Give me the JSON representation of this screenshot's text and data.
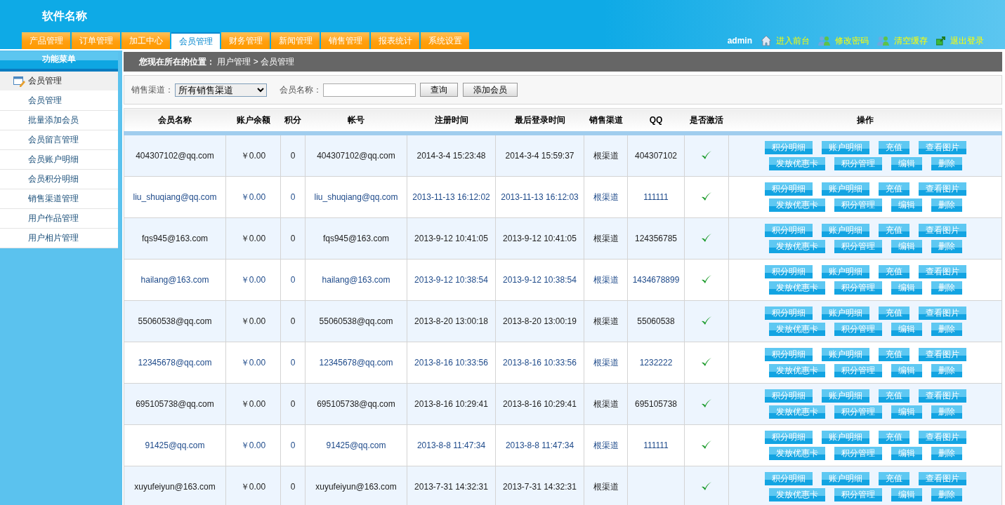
{
  "header": {
    "title": "软件名称",
    "user": "admin",
    "links": [
      {
        "kind": "home",
        "label": "进入前台"
      },
      {
        "kind": "users",
        "label": "修改密码"
      },
      {
        "kind": "users",
        "label": "清空缓存"
      },
      {
        "kind": "exit",
        "label": "退出登录"
      }
    ]
  },
  "tabs": [
    {
      "label": "产品管理",
      "selected": false
    },
    {
      "label": "订单管理",
      "selected": false
    },
    {
      "label": "加工中心",
      "selected": false
    },
    {
      "label": "会员管理",
      "selected": true
    },
    {
      "label": "财务管理",
      "selected": false
    },
    {
      "label": "新闻管理",
      "selected": false
    },
    {
      "label": "销售管理",
      "selected": false
    },
    {
      "label": "报表统计",
      "selected": false
    },
    {
      "label": "系统设置",
      "selected": false
    }
  ],
  "sidebar": {
    "title": "功能菜单",
    "groups": [
      {
        "label": "会员管理",
        "children": [
          {
            "label": "会员管理"
          },
          {
            "label": "批量添加会员"
          },
          {
            "label": "会员留言管理"
          },
          {
            "label": "会员账户明细"
          },
          {
            "label": "会员积分明细"
          },
          {
            "label": "销售渠道管理"
          },
          {
            "label": "用户作品管理"
          },
          {
            "label": "用户相片管理"
          }
        ]
      }
    ]
  },
  "breadcrumb": "**您现在所在的位置：** 用户管理 > 会员管理",
  "filter": {
    "channel_label": "销售渠道：",
    "channel_value": "所有销售渠道",
    "name_label": "会员名称：",
    "buttons": [
      "查询",
      "添加会员"
    ]
  },
  "table": {
    "columns": [
      "会员名称",
      "账户余额",
      "积分",
      "帐号",
      "注册时间",
      "最后登录时间",
      "销售渠道",
      "QQ",
      "是否激活",
      "操作"
    ],
    "rows": [
      {
        "name": "404307102@qq.com",
        "balance": "￥0.00",
        "points": "0",
        "account": "404307102@qq.com",
        "registered": "2014-3-4 15:23:48",
        "last_login": "2014-3-4 15:59:37",
        "channel": "根渠道",
        "qq": "404307102",
        "active": true,
        "actions": [
          [
            "积分明细",
            "账户明细",
            "充值",
            "查看图片"
          ],
          [
            "发放优惠卡",
            "积分管理",
            "编辑",
            "删除"
          ]
        ]
      },
      {
        "name": "liu_shuqiang@qq.com",
        "balance": "￥0.00",
        "points": "0",
        "account": "liu_shuqiang@qq.com",
        "registered": "2013-11-13 16:12:02",
        "last_login": "2013-11-13 16:12:03",
        "channel": "根渠道",
        "qq": "111111",
        "active": true,
        "actions": [
          [
            "积分明细",
            "账户明细",
            "充值",
            "查看图片"
          ],
          [
            "发放优惠卡",
            "积分管理",
            "编辑",
            "删除"
          ]
        ]
      },
      {
        "name": "fqs945@163.com",
        "balance": "￥0.00",
        "points": "0",
        "account": "fqs945@163.com",
        "registered": "2013-9-12 10:41:05",
        "last_login": "2013-9-12 10:41:05",
        "channel": "根渠道",
        "qq": "124356785",
        "active": true,
        "actions": [
          [
            "积分明细",
            "账户明细",
            "充值",
            "查看图片"
          ],
          [
            "发放优惠卡",
            "积分管理",
            "编辑",
            "删除"
          ]
        ]
      },
      {
        "name": "hailang@163.com",
        "balance": "￥0.00",
        "points": "0",
        "account": "hailang@163.com",
        "registered": "2013-9-12 10:38:54",
        "last_login": "2013-9-12 10:38:54",
        "channel": "根渠道",
        "qq": "1434678899",
        "active": true,
        "actions": [
          [
            "积分明细",
            "账户明细",
            "充值",
            "查看图片"
          ],
          [
            "发放优惠卡",
            "积分管理",
            "编辑",
            "删除"
          ]
        ]
      },
      {
        "name": "55060538@qq.com",
        "balance": "￥0.00",
        "points": "0",
        "account": "55060538@qq.com",
        "registered": "2013-8-20 13:00:18",
        "last_login": "2013-8-20 13:00:19",
        "channel": "根渠道",
        "qq": "55060538",
        "active": true,
        "actions": [
          [
            "积分明细",
            "账户明细",
            "充值",
            "查看图片"
          ],
          [
            "发放优惠卡",
            "积分管理",
            "编辑",
            "删除"
          ]
        ]
      },
      {
        "name": "12345678@qq.com",
        "balance": "￥0.00",
        "points": "0",
        "account": "12345678@qq.com",
        "registered": "2013-8-16 10:33:56",
        "last_login": "2013-8-16 10:33:56",
        "channel": "根渠道",
        "qq": "1232222",
        "active": true,
        "actions": [
          [
            "积分明细",
            "账户明细",
            "充值",
            "查看图片"
          ],
          [
            "发放优惠卡",
            "积分管理",
            "编辑",
            "删除"
          ]
        ]
      },
      {
        "name": "695105738@qq.com",
        "balance": "￥0.00",
        "points": "0",
        "account": "695105738@qq.com",
        "registered": "2013-8-16 10:29:41",
        "last_login": "2013-8-16 10:29:41",
        "channel": "根渠道",
        "qq": "695105738",
        "active": true,
        "actions": [
          [
            "积分明细",
            "账户明细",
            "充值",
            "查看图片"
          ],
          [
            "发放优惠卡",
            "积分管理",
            "编辑",
            "删除"
          ]
        ]
      },
      {
        "name": "91425@qq.com",
        "balance": "￥0.00",
        "points": "0",
        "account": "91425@qq.com",
        "registered": "2013-8-8 11:47:34",
        "last_login": "2013-8-8 11:47:34",
        "channel": "根渠道",
        "qq": "111111",
        "active": true,
        "actions": [
          [
            "积分明细",
            "账户明细",
            "充值",
            "查看图片"
          ],
          [
            "发放优惠卡",
            "积分管理",
            "编辑",
            "删除"
          ]
        ]
      },
      {
        "name": "xuyufeiyun@163.com",
        "balance": "￥0.00",
        "points": "0",
        "account": "xuyufeiyun@163.com",
        "registered": "2013-7-31 14:32:31",
        "last_login": "2013-7-31 14:32:31",
        "channel": "根渠道",
        "active": true,
        "actions": [
          [
            "积分明细",
            "账户明细",
            "充值",
            "查看图片"
          ],
          [
            "发放优惠卡",
            "积分管理",
            "编辑",
            "删除"
          ]
        ]
      }
    ]
  }
}
